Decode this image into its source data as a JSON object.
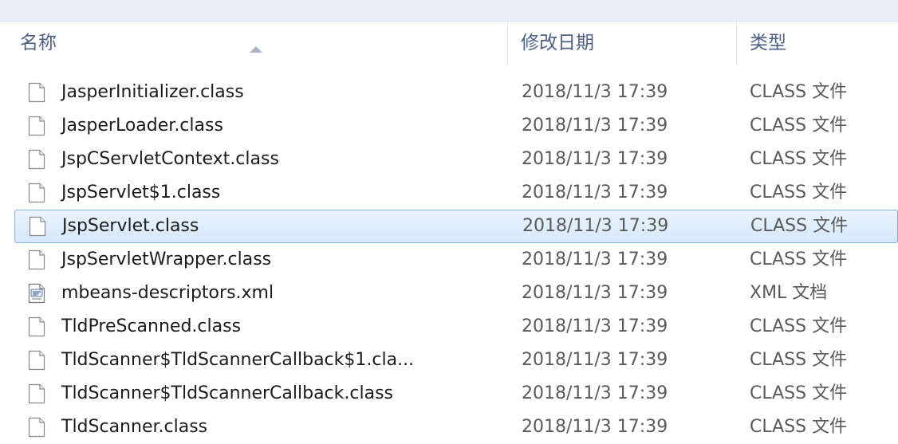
{
  "columns": {
    "name": "名称",
    "date": "修改日期",
    "type": "类型"
  },
  "files": [
    {
      "name": "JasperInitializer.class",
      "date": "2018/11/3 17:39",
      "type": "CLASS 文件",
      "icon": "blank-file-icon"
    },
    {
      "name": "JasperLoader.class",
      "date": "2018/11/3 17:39",
      "type": "CLASS 文件",
      "icon": "blank-file-icon"
    },
    {
      "name": "JspCServletContext.class",
      "date": "2018/11/3 17:39",
      "type": "CLASS 文件",
      "icon": "blank-file-icon"
    },
    {
      "name": "JspServlet$1.class",
      "date": "2018/11/3 17:39",
      "type": "CLASS 文件",
      "icon": "blank-file-icon"
    },
    {
      "name": "JspServlet.class",
      "date": "2018/11/3 17:39",
      "type": "CLASS 文件",
      "icon": "blank-file-icon",
      "selected": true
    },
    {
      "name": "JspServletWrapper.class",
      "date": "2018/11/3 17:39",
      "type": "CLASS 文件",
      "icon": "blank-file-icon"
    },
    {
      "name": "mbeans-descriptors.xml",
      "date": "2018/11/3 17:39",
      "type": "XML 文档",
      "icon": "xml-file-icon"
    },
    {
      "name": "TldPreScanned.class",
      "date": "2018/11/3 17:39",
      "type": "CLASS 文件",
      "icon": "blank-file-icon"
    },
    {
      "name": "TldScanner$TldScannerCallback$1.cla...",
      "date": "2018/11/3 17:39",
      "type": "CLASS 文件",
      "icon": "blank-file-icon"
    },
    {
      "name": "TldScanner$TldScannerCallback.class",
      "date": "2018/11/3 17:39",
      "type": "CLASS 文件",
      "icon": "blank-file-icon"
    },
    {
      "name": "TldScanner.class",
      "date": "2018/11/3 17:39",
      "type": "CLASS 文件",
      "icon": "blank-file-icon"
    }
  ]
}
